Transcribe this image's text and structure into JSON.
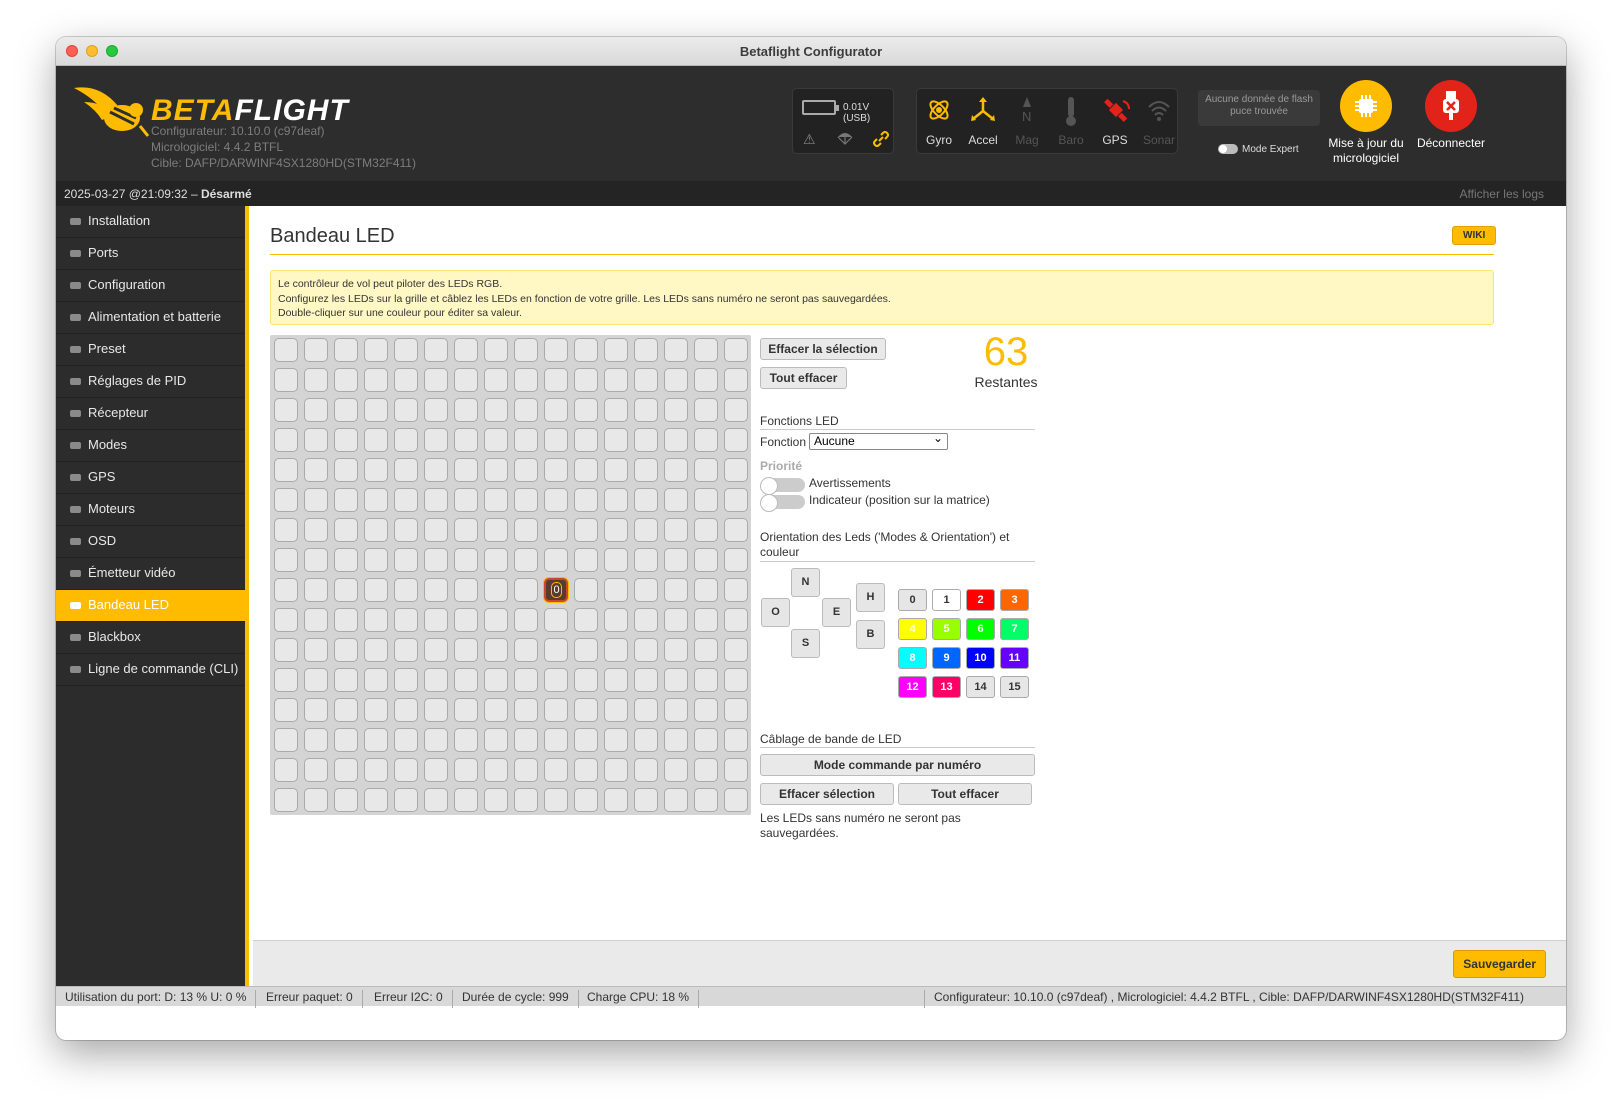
{
  "window": {
    "title": "Betaflight Configurator"
  },
  "header": {
    "brand_a": "BETA",
    "brand_b": "FLIGHT",
    "configurator": "Configurateur: 10.10.0 (c97deaf)",
    "firmware": "Micrologiciel: 4.4.2 BTFL",
    "target": "Cible: DAFP/DARWINF4SX1280HD(STM32F411)",
    "battery": "0.01V (USB)",
    "sensors": [
      {
        "label": "Gyro",
        "active": true,
        "icon": "gyro-icon"
      },
      {
        "label": "Accel",
        "active": true,
        "icon": "accel-icon"
      },
      {
        "label": "Mag",
        "active": false,
        "icon": "mag-icon"
      },
      {
        "label": "Baro",
        "active": false,
        "icon": "baro-icon"
      },
      {
        "label": "GPS",
        "active": true,
        "icon": "gps-icon"
      },
      {
        "label": "Sonar",
        "active": false,
        "icon": "sonar-icon"
      }
    ],
    "flash": "Aucune donnée de flash puce trouvée",
    "expert_mode": "Mode Expert",
    "firmware_update": "Mise à jour du micrologiciel",
    "disconnect": "Déconnecter"
  },
  "status": {
    "datetime": "2025-03-27 @21:09:32 –",
    "arm_state": "Désarmé",
    "show_logs": "Afficher les logs"
  },
  "sidebar": {
    "items": [
      {
        "label": "Installation",
        "icon": "wrench-icon"
      },
      {
        "label": "Ports",
        "icon": "plug-icon"
      },
      {
        "label": "Configuration",
        "icon": "gear-icon"
      },
      {
        "label": "Alimentation et batterie",
        "icon": "battery-icon"
      },
      {
        "label": "Preset",
        "icon": "wand-icon"
      },
      {
        "label": "Réglages de PID",
        "icon": "sitemap-icon"
      },
      {
        "label": "Récepteur",
        "icon": "remote-icon"
      },
      {
        "label": "Modes",
        "icon": "modes-icon"
      },
      {
        "label": "GPS",
        "icon": "satellite-icon"
      },
      {
        "label": "Moteurs",
        "icon": "motor-icon"
      },
      {
        "label": "OSD",
        "icon": "osd-icon"
      },
      {
        "label": "Émetteur vidéo",
        "icon": "antenna-icon"
      },
      {
        "label": "Bandeau LED",
        "icon": "bulb-icon",
        "active": true
      },
      {
        "label": "Blackbox",
        "icon": "blackbox-icon"
      },
      {
        "label": "Ligne de commande (CLI)",
        "icon": "terminal-icon"
      }
    ]
  },
  "page": {
    "title": "Bandeau LED",
    "wiki": "WIKI",
    "note_lines": [
      "Le contrôleur de vol peut piloter des LEDs RGB.",
      "Configurez les LEDs sur la grille et câblez les LEDs en fonction de votre grille. Les LEDs sans numéro ne seront pas sauvegardées.",
      "Double-cliquer sur une couleur pour éditer sa valeur."
    ],
    "grid_selected_label": "0",
    "clear_selection": "Effacer la sélection",
    "clear_all": "Tout effacer",
    "remaining_count": "63",
    "remaining_label": "Restantes",
    "functions_title": "Fonctions LED",
    "function_label": "Fonction",
    "function_value": "Aucune",
    "priority_label": "Priorité",
    "warnings_label": "Avertissements",
    "indicator_label": "Indicateur (position sur la matrice)",
    "orientation_title": "Orientation des Leds ('Modes & Orientation') et couleur",
    "directions": {
      "n": "N",
      "o": "O",
      "e": "E",
      "s": "S",
      "h": "H",
      "b": "B"
    },
    "colors": [
      {
        "label": "0",
        "bg": "#e6e6e6",
        "light": true
      },
      {
        "label": "1",
        "bg": "#ffffff",
        "light": true
      },
      {
        "label": "2",
        "bg": "#ff0000"
      },
      {
        "label": "3",
        "bg": "#ff6600"
      },
      {
        "label": "4",
        "bg": "#ffff00"
      },
      {
        "label": "5",
        "bg": "#99ff00"
      },
      {
        "label": "6",
        "bg": "#00ff00"
      },
      {
        "label": "7",
        "bg": "#00ff66"
      },
      {
        "label": "8",
        "bg": "#00ffff"
      },
      {
        "label": "9",
        "bg": "#0066ff"
      },
      {
        "label": "10",
        "bg": "#0000ff"
      },
      {
        "label": "11",
        "bg": "#6600ff"
      },
      {
        "label": "12",
        "bg": "#ff00ff"
      },
      {
        "label": "13",
        "bg": "#ff0066"
      },
      {
        "label": "14",
        "bg": "#e6e6e6",
        "light": true
      },
      {
        "label": "15",
        "bg": "#e6e6e6",
        "light": true
      }
    ],
    "wiring_title": "Câblage de bande de LED",
    "wire_mode": "Mode commande par numéro",
    "wire_clear_selection": "Effacer sélection",
    "wire_clear_all": "Tout effacer",
    "wire_note": "Les LEDs sans numéro ne seront pas sauvegardées.",
    "save": "Sauvegarder"
  },
  "bottom": {
    "port_usage": "Utilisation du port: D: 13 % U: 0 %",
    "packet_error": "Erreur paquet: 0",
    "i2c_error": "Erreur I2C: 0",
    "cycle_time": "Durée de cycle: 999",
    "cpu_load": "Charge CPU: 18 %",
    "versions": "Configurateur: 10.10.0 (c97deaf) , Micrologiciel: 4.4.2 BTFL , Cible: DAFP/DARWINF4SX1280HD(STM32F411)"
  },
  "colors": {
    "accent": "#ffbb00",
    "dark": "#2d2d2d",
    "disconnect": "#e2231a"
  }
}
